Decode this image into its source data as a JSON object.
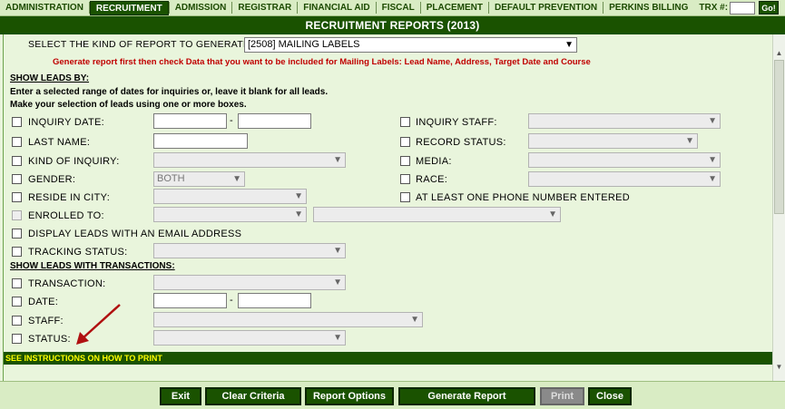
{
  "nav": {
    "tabs": [
      "ADMINISTRATION",
      "RECRUITMENT",
      "ADMISSION",
      "REGISTRAR",
      "FINANCIAL AID",
      "FISCAL",
      "PLACEMENT",
      "DEFAULT PREVENTION",
      "PERKINS BILLING"
    ],
    "active_tab": "RECRUITMENT",
    "trx_label": "TRX #:",
    "trx_value": "",
    "go_label": "Go!"
  },
  "title": "RECRUITMENT REPORTS (2013)",
  "report_select": {
    "label": "SELECT THE KIND OF REPORT TO GENERATE:",
    "value": "[2508] MAILING LABELS",
    "note": "Generate report first then check Data that you want to be included for Mailing Labels:  Lead Name, Address, Target Date and Course"
  },
  "show_leads": {
    "header": "SHOW LEADS BY:",
    "instructions": [
      "Enter a selected range of dates for inquiries or, leave it blank for all leads.",
      "Make your selection of leads using one or more boxes."
    ],
    "fields": {
      "inquiry_date": "INQUIRY DATE:",
      "date_separator": "-",
      "last_name": "LAST NAME:",
      "kind_of_inquiry": "KIND OF INQUIRY:",
      "gender": "GENDER:",
      "gender_value": "BOTH",
      "reside_in_city": "RESIDE IN CITY:",
      "enrolled_to": "ENROLLED TO:",
      "display_email": "DISPLAY LEADS WITH AN EMAIL ADDRESS",
      "tracking_status": "TRACKING STATUS:",
      "inquiry_staff": "INQUIRY STAFF:",
      "record_status": "RECORD STATUS:",
      "media": "MEDIA:",
      "race": "RACE:",
      "phone_entered": "AT LEAST ONE PHONE NUMBER ENTERED"
    }
  },
  "transactions": {
    "header": "SHOW LEADS WITH TRANSACTIONS:",
    "fields": {
      "transaction": "TRANSACTION:",
      "date": "DATE:",
      "date_separator": "-",
      "staff": "STAFF:",
      "status": "STATUS:"
    }
  },
  "instructions_bar": "SEE INSTRUCTIONS ON HOW TO PRINT",
  "footer": {
    "exit": "Exit",
    "clear": "Clear Criteria",
    "options": "Report Options",
    "generate": "Generate Report",
    "print": "Print",
    "close": "Close"
  },
  "colors": {
    "dark_green": "#1a5200",
    "panel_green": "#e9f5dc",
    "note_red": "#c00000",
    "highlight_yellow": "#ffff00",
    "arrow_red": "#b01010"
  }
}
